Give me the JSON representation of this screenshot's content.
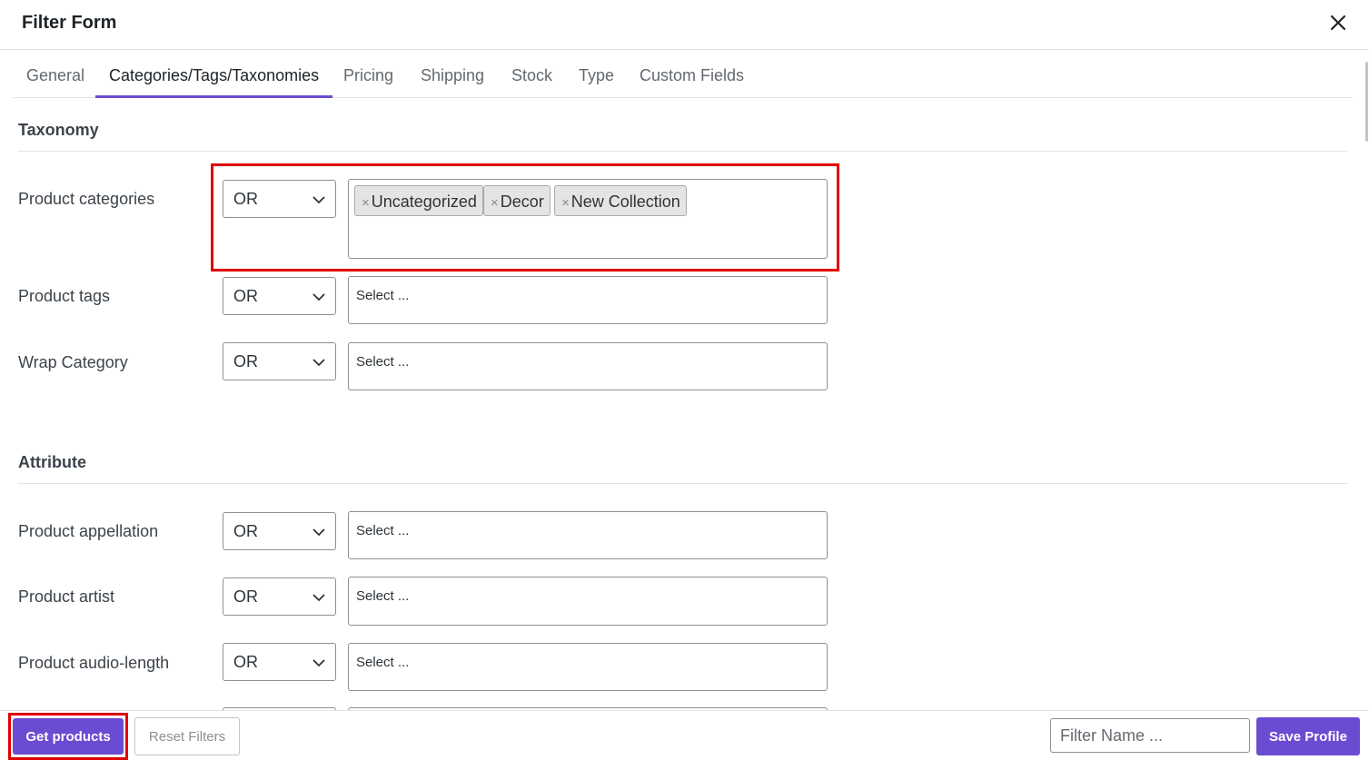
{
  "header": {
    "title": "Filter Form",
    "close_icon": "close-icon"
  },
  "tabs": [
    {
      "label": "General"
    },
    {
      "label": "Categories/Tags/Taxonomies",
      "active": true
    },
    {
      "label": "Pricing"
    },
    {
      "label": "Shipping"
    },
    {
      "label": "Stock"
    },
    {
      "label": "Type"
    },
    {
      "label": "Custom Fields"
    }
  ],
  "taxonomy": {
    "title": "Taxonomy",
    "rows": [
      {
        "label": "Product categories",
        "operator": "OR",
        "chips": [
          "Uncategorized",
          "Decor",
          "New Collection"
        ]
      },
      {
        "label": "Product tags",
        "operator": "OR",
        "placeholder": "Select ..."
      },
      {
        "label": "Wrap Category",
        "operator": "OR",
        "placeholder": "Select ..."
      }
    ]
  },
  "attribute": {
    "title": "Attribute",
    "rows": [
      {
        "label": "Product appellation",
        "operator": "OR",
        "placeholder": "Select ..."
      },
      {
        "label": "Product artist",
        "operator": "OR",
        "placeholder": "Select ..."
      },
      {
        "label": "Product audio-length",
        "operator": "OR",
        "placeholder": "Select ..."
      }
    ]
  },
  "chip_remove_glyph": "×",
  "footer": {
    "get_products_label": "Get products",
    "reset_filters_label": "Reset Filters",
    "filter_name_placeholder": "Filter Name ...",
    "save_profile_label": "Save Profile"
  },
  "colors": {
    "accent": "#6b4bd1",
    "highlight": "#e00000"
  }
}
